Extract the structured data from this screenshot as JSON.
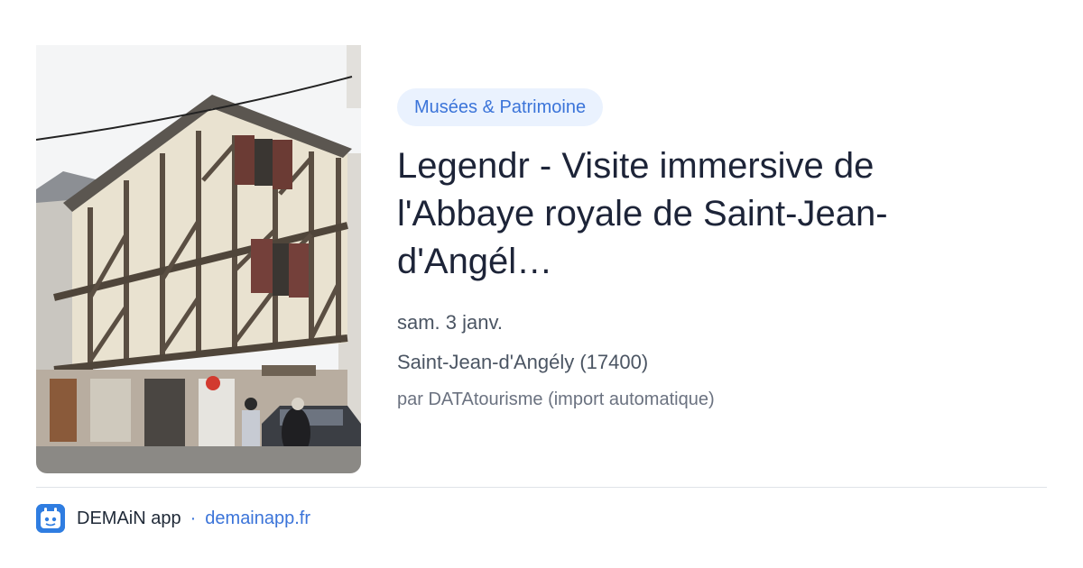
{
  "event": {
    "category": "Musées & Patrimoine",
    "title": "Legendr - Visite immersive de l'Abbaye royale de Saint-Jean-d'Angél…",
    "date": "sam. 3 janv.",
    "location": "Saint-Jean-d'Angély (17400)",
    "author": "par DATAtourisme (import automatique)",
    "image_icon": "half-timbered-house-photo"
  },
  "footer": {
    "app_name": "DEMAiN app",
    "separator": "·",
    "domain": "demainapp.fr",
    "logo_icon": "demain-app-logo-icon",
    "brand_color": "#2f7de1",
    "link_color": "#3b74d9"
  },
  "colors": {
    "tag_background": "#eaf2fe",
    "title_text": "#1d2438"
  }
}
